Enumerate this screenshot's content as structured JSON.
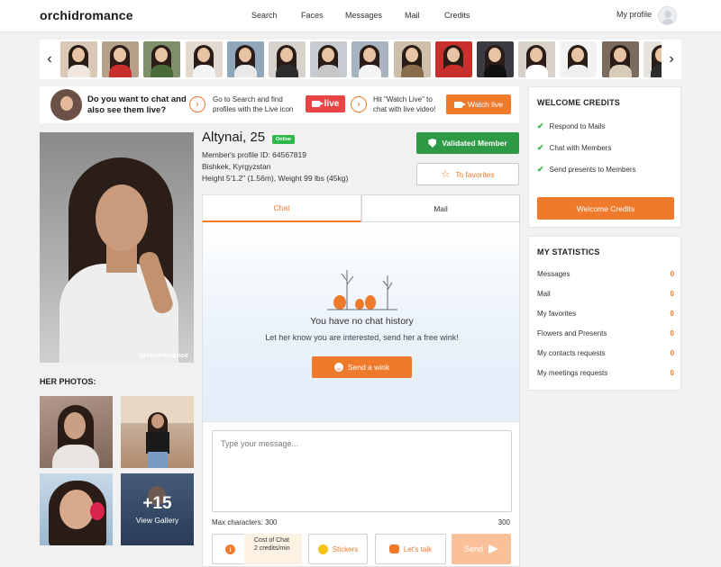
{
  "header": {
    "logo": "orchidromance",
    "nav": [
      "Search",
      "Faces",
      "Messages",
      "Mail",
      "Credits"
    ],
    "profile_label": "My profile"
  },
  "carousel": {
    "prev_icon": "chevron-left-icon",
    "next_icon": "chevron-right-icon",
    "thumb_count": 15
  },
  "promo": {
    "question": "Do you want to chat and also see them live?",
    "search_text": "Go to Search and find profiles with the Live icon",
    "live_label": "live",
    "watch_text": "Hit \"Watch Live\" to chat with live video!",
    "watch_label": "Watch live"
  },
  "profile": {
    "name": "Altynai, 25",
    "online_badge": "Online",
    "member_id": "Member's profile ID: 64567819",
    "location": "Bishkek, Kyrgyzstan",
    "body": "Height 5'1.2\" (1.56m), Weight 99 lbs (45kg)",
    "validated_label": "Validated Member",
    "favorites_label": "To favorites",
    "photo_watermark": "orchidromance"
  },
  "photos": {
    "heading": "HER PHOTOS:",
    "gallery_count": "+15",
    "gallery_label": "View Gallery"
  },
  "chat": {
    "tab_chat": "Chat",
    "tab_mail": "Mail",
    "empty_title": "You have no chat history",
    "empty_sub": "Let her know you are interested, send her a free wink!",
    "wink_label": "Send a wink",
    "placeholder": "Type your message...",
    "max_label": "Max characters: 300",
    "max_count": "300",
    "info_label": "i",
    "cost_title": "Cost of Chat",
    "cost_value": "2 credits/min",
    "stickers_label": "Stickers",
    "talk_label": "Let's talk",
    "send_label": "Send"
  },
  "welcome": {
    "title": "WELCOME CREDITS",
    "items": [
      "Respond to Mails",
      "Chat with Members",
      "Send presents to Members"
    ],
    "button": "Welcome Credits"
  },
  "stats": {
    "title": "MY STATISTICS",
    "rows": [
      {
        "label": "Messages",
        "value": "0"
      },
      {
        "label": "Mail",
        "value": "0"
      },
      {
        "label": "My favorites",
        "value": "0"
      },
      {
        "label": "Flowers and Presents",
        "value": "0"
      },
      {
        "label": "My contacts requests",
        "value": "0"
      },
      {
        "label": "My meetings requests",
        "value": "0"
      }
    ]
  },
  "colors": {
    "accent": "#f07a2c",
    "green": "#2f9a45",
    "live_red": "#ea4545",
    "send_disabled": "#f9c09a"
  }
}
